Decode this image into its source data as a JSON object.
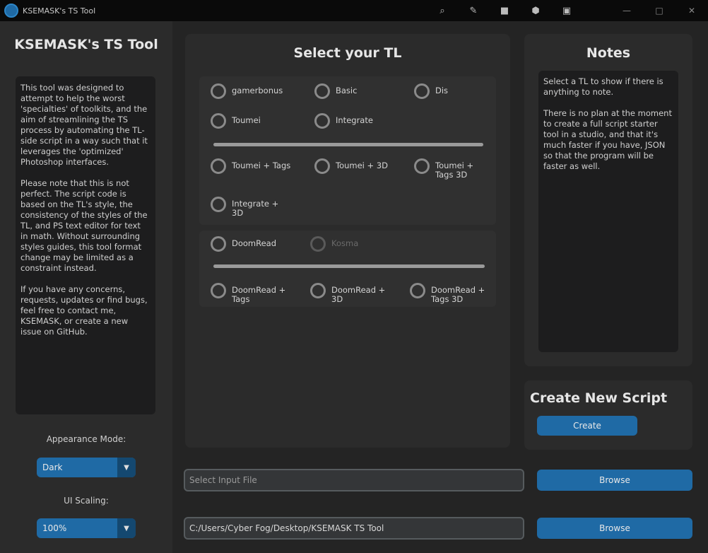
{
  "titlebar": {
    "title": "KSEMASK's TS Tool",
    "tools": [
      "⌕",
      "✎",
      "■",
      "⬢",
      "▣"
    ],
    "controls": [
      "—",
      "□",
      "✕"
    ]
  },
  "sidebar": {
    "title": "KSEMASK's TS Tool",
    "description": [
      "This tool was designed to attempt to help the worst 'specialties' of toolkits, and the aim of streamlining the TS process by automating the TL-side script in a way such that it leverages the 'optimized' Photoshop interfaces.",
      "Please note that this is not perfect. The script code is based on the TL's style, the consistency of the styles of the TL, and PS text editor for text in math. Without surrounding styles guides, this tool format change may be limited as a constraint instead.",
      "If you have any concerns, requests, updates or find bugs, feel free to contact me, KSEMASK, or create a new issue on GitHub."
    ],
    "appearance_label": "Appearance Mode:",
    "appearance_value": "Dark",
    "scaling_label": "UI Scaling:",
    "scaling_value": "100%",
    "dropdown_arrow": "▼"
  },
  "center": {
    "title": "Select your TL",
    "group1": {
      "options": [
        "gamerbonus",
        "Basic",
        "Dis",
        "Toumei",
        "Integrate"
      ],
      "options2": [
        "Toumei + Tags",
        "Toumei + 3D",
        "Toumei + Tags 3D",
        "Integrate + 3D"
      ]
    },
    "group2": {
      "options": [
        "DoomRead",
        "Kosma"
      ],
      "options2": [
        "DoomRead + Tags",
        "DoomRead + 3D",
        "DoomRead + Tags 3D"
      ]
    }
  },
  "notes": {
    "title": "Notes",
    "text": [
      "Select a TL to show if there is anything to note.",
      "There is no plan at the moment to create a full script starter tool in a studio, and that it's much faster if you have, JSON so that the program will be faster as well."
    ]
  },
  "create": {
    "title": "Create New Script",
    "button": "Create"
  },
  "files": {
    "input_placeholder": "Select Input File",
    "output_value": "C:/Users/Cyber Fog/Desktop/KSEMASK TS Tool",
    "browse_label": "Browse"
  },
  "colors": {
    "accent": "#1f6aa5",
    "accent_dark": "#144870",
    "background": "#242424",
    "panel": "#2b2b2b",
    "textbox": "#1d1d1e"
  }
}
